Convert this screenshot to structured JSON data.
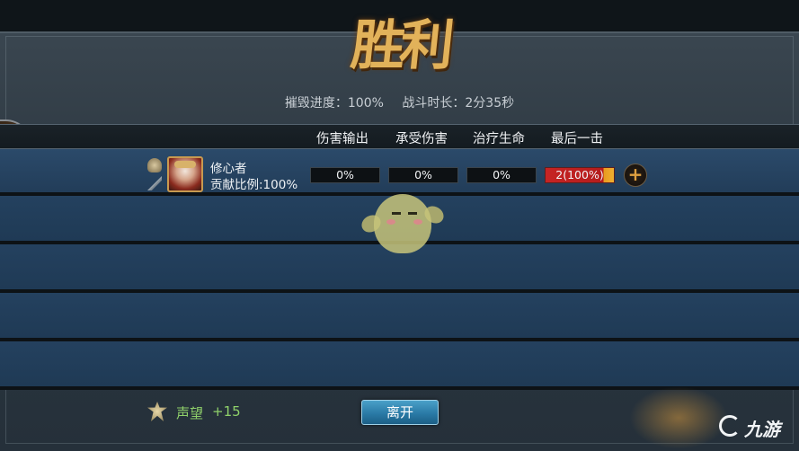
{
  "title": "胜利",
  "summary": {
    "destroy_progress": "摧毁进度：100%",
    "battle_duration": "战斗时长：2分35秒"
  },
  "columns": [
    "伤害输出",
    "承受伤害",
    "治疗生命",
    "最后一击"
  ],
  "player": {
    "name": "修心者",
    "contribution": "贡献比例:100%",
    "stats": [
      "0%",
      "0%",
      "0%",
      "2(100%)"
    ]
  },
  "footer": {
    "reputation_label": "声望",
    "reputation_value": "+15",
    "leave_button": "离开"
  },
  "watermark": {
    "text": "九游"
  },
  "icons": {
    "rank": "rank-medal-icon",
    "kills": "sword-icon",
    "add": "plus-icon",
    "reputation": "laurel-icon",
    "side": "pet-paw-icon"
  },
  "colors": {
    "title": "#e2b25a",
    "row": "#223d59",
    "last_hit_bar": "#c62424",
    "reputation": "#8fd06a",
    "button": "#2a7aa6"
  }
}
